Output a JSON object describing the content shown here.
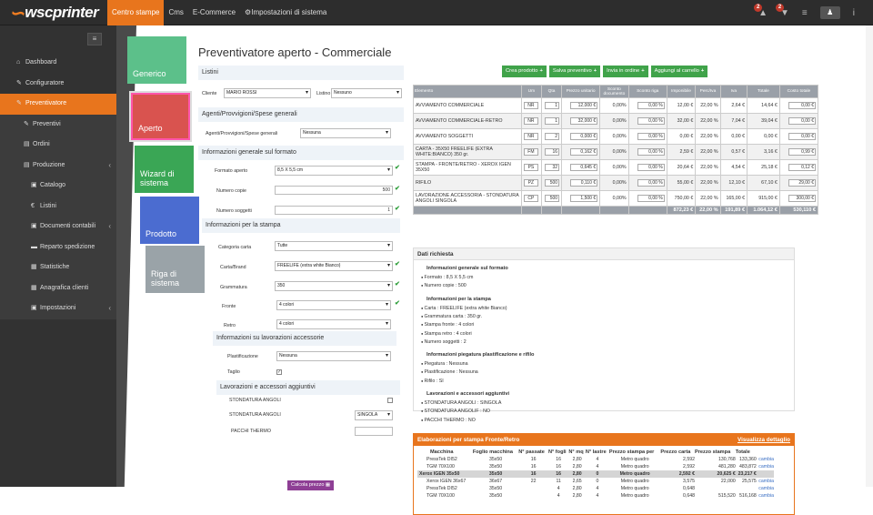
{
  "brand": {
    "logo_text": "wscprinter"
  },
  "topnav": [
    "Centro stampe",
    "Cms",
    "E-Commerce",
    "Impostazioni di sistema"
  ],
  "topbar": {
    "notif1": "2",
    "notif2": "2",
    "menu_icon": "≡",
    "info_icon": "i"
  },
  "sidebar": {
    "collapse_icon": "≡",
    "items": [
      {
        "icon": "⌂",
        "label": "Dashboard"
      },
      {
        "icon": "✎",
        "label": "Configuratore"
      },
      {
        "icon": "✎",
        "label": "Preventivatore"
      },
      {
        "icon": "✎",
        "label": "Preventivi"
      },
      {
        "icon": "▤",
        "label": "Ordini"
      },
      {
        "icon": "▤",
        "label": "Produzione",
        "arrow": "‹"
      },
      {
        "icon": "▣",
        "label": "Catalogo"
      },
      {
        "icon": "€",
        "label": "Listini"
      },
      {
        "icon": "▣",
        "label": "Documenti contabili",
        "arrow": "‹"
      },
      {
        "icon": "▬",
        "label": "Reparto spedizione"
      },
      {
        "icon": "▦",
        "label": "Statistiche"
      },
      {
        "icon": "▦",
        "label": "Anagrafica clienti"
      },
      {
        "icon": "▣",
        "label": "Impostazioni",
        "arrow": "‹"
      }
    ]
  },
  "tiles": [
    "Generico",
    "Aperto",
    "Wizard di sistema",
    "Prodotto",
    "Riga di sistema"
  ],
  "page_title": "Preventivatore aperto - Commerciale",
  "form": {
    "listini_section": "Listini",
    "cliente_label": "Cliente",
    "cliente_value": "MARIO ROSSI",
    "listino_label": "Listino",
    "listino_value": "Nessuno",
    "agenti_section": "Agenti/Provvigioni/Spese generali",
    "agenti_label": "Agenti/Provvigioni/Spese generali",
    "agenti_value": "Nessuna",
    "info_formato_section": "Informazioni generale sul formato",
    "formato_label": "Formato aperto",
    "formato_value": "8,5 X 5,5 cm",
    "copie_label": "Numero copie",
    "copie_value": "500",
    "soggetti_label": "Numero soggetti",
    "soggetti_value": "1",
    "stampa_section": "Informazioni per la stampa",
    "categoria_label": "Categoria carta",
    "categoria_value": "Tutte",
    "carta_label": "Carta/Brand",
    "carta_value": "FREELIFE (extra white Bianco)",
    "grammatura_label": "Grammatura",
    "grammatura_value": "350",
    "fronte_label": "Fronte",
    "fronte_value": "4 colori",
    "retro_label": "Retro",
    "retro_value": "4 colori",
    "lavorazioni_section": "Informazioni su lavorazioni accessorie",
    "plast_label": "Plastificazione",
    "plast_value": "Nessuna",
    "taglio_label": "Taglio",
    "accessori_section": "Lavorazioni e accessori aggiuntivi",
    "std_angoli_f_label": "STONDATURA ANGOLI",
    "std_angoli_label": "STONDATURA ANGOLI",
    "std_angoli_value": "SINGOLA",
    "pacchi_label": "PACCHI THERMO",
    "calc_button": "Calcola prezzo"
  },
  "actions": [
    "Crea prodotto",
    "Salva preventivo",
    "Invia in ordine",
    "Aggiungi al carrello"
  ],
  "elements_table": {
    "headers": [
      "Elemento",
      "Um",
      "Qta",
      "Prezzo unitario",
      "Sconto documento",
      "Sconto riga",
      "Imponibile",
      "Perc/Iva",
      "Iva",
      "Totale",
      "Costo totale"
    ],
    "rows": [
      [
        "AVVIAMENTO COMMERCIALE",
        "NR",
        "1",
        "12,000 €",
        "0,00%",
        "0,00 %",
        "12,00 €",
        "22,00 %",
        "2,64 €",
        "14,64 €",
        "0,00 €"
      ],
      [
        "AVVIAMENTO COMMERCIALE-RETRO",
        "NR",
        "1",
        "32,000 €",
        "0,00%",
        "0,00 %",
        "32,00 €",
        "22,00 %",
        "7,04 €",
        "39,04 €",
        "0,00 €"
      ],
      [
        "AVVIAMENTO SOGGETTI",
        "NR",
        "2",
        "0,000 €",
        "0,00%",
        "0,00 %",
        "0,00 €",
        "22,00 %",
        "0,00 €",
        "0,00 €",
        "0,00 €"
      ],
      [
        "CARTA - 35X50 FREELIFE (EXTRA WHITE:BIANCO) 350 gr.",
        "FM",
        "16",
        "0,162 €",
        "0,00%",
        "0,00 %",
        "2,59 €",
        "22,00 %",
        "0,57 €",
        "3,16 €",
        "0,99 €"
      ],
      [
        "STAMPA - FRONTE/RETRO - XEROX IGEN 35X50",
        "PS",
        "32",
        "0,645 €",
        "0,00%",
        "0,00 %",
        "20,64 €",
        "22,00 %",
        "4,54 €",
        "25,18 €",
        "0,12 €"
      ],
      [
        "RIFILO",
        "PZ",
        "500",
        "0,110 €",
        "0,00%",
        "0,00 %",
        "55,00 €",
        "22,00 %",
        "12,10 €",
        "67,10 €",
        "29,00 €"
      ],
      [
        "LAVORAZIONE ACCESSORIA - STONDATURA ANGOLI SINGOLA",
        "CP",
        "500",
        "1,500 €",
        "0,00%",
        "0,00 %",
        "750,00 €",
        "22,00 %",
        "165,00 €",
        "915,00 €",
        "300,00 €"
      ]
    ],
    "totals": [
      "872,23 €",
      "22,00 %",
      "191,89 €",
      "1.064,12 €",
      "530,110 €"
    ]
  },
  "dati_richiesta": {
    "header": "Dati richiesta",
    "sections": [
      {
        "title": "Informazioni generale sul formato",
        "items": [
          "Formato : 8,5 X 5,5 cm",
          "Numero copie : 500"
        ]
      },
      {
        "title": "Informazioni per la stampa",
        "items": [
          "Carta : FREELIFE (extra white Bianco)",
          "Grammatura carta : 350 gr.",
          "Stampa fronte : 4 colori",
          "Stampa retro : 4 colori",
          "Numero soggetti : 2"
        ]
      },
      {
        "title": "Informazioni piegatura plastificazione e rifilo",
        "items": [
          "Piegatura : Nessuna",
          "Plastificazione : Nessuna",
          "Rifilo : SI"
        ]
      },
      {
        "title": "Lavorazioni e accessori aggiuntivi",
        "items": [
          "STONDATURA ANGOLI : SINGOLA",
          "STONDATURA ANGOLIF : NO",
          "PACCHI THERMO : NO"
        ]
      }
    ]
  },
  "elaborazioni": {
    "header": "Elaborazioni per stampa Fronte/Retro",
    "link": "Visualizza dettaglio",
    "headers": [
      "Macchina",
      "Foglio macchina",
      "N° passate",
      "N° fogli",
      "N° mq",
      "N° lastre",
      "Prezzo stampa per",
      "Prezzo carta",
      "Prezzo stampa",
      "Totale",
      ""
    ],
    "rows": [
      [
        "PressTek DI52",
        "35x50",
        "16",
        "16",
        "2,80",
        "4",
        "Metro quadro",
        "2,592",
        "130,768",
        "133,360",
        "cambia"
      ],
      [
        "TGM 70X100",
        "35x50",
        "16",
        "16",
        "2,80",
        "4",
        "Metro quadro",
        "2,592",
        "481,280",
        "483,872",
        "cambia"
      ],
      [
        "Xerox IGEN 35x50",
        "35x50",
        "16",
        "16",
        "2,80",
        "0",
        "Metro quadro",
        "2,592 €",
        "20,625 €",
        "23,217 €",
        ""
      ],
      [
        "Xerox IGEN 36x67",
        "36x67",
        "22",
        "11",
        "2,65",
        "0",
        "Metro quadro",
        "3,575",
        "22,000",
        "25,575",
        "cambia"
      ],
      [
        "PressTek DI52",
        "35x50",
        "",
        "4",
        "2,80",
        "4",
        "Metro quadro",
        "0,648",
        "",
        "",
        "cambia"
      ],
      [
        "TGM 70X100",
        "35x50",
        "",
        "4",
        "2,80",
        "4",
        "Metro quadro",
        "0,648",
        "515,520",
        "516,168",
        "cambia"
      ]
    ]
  }
}
